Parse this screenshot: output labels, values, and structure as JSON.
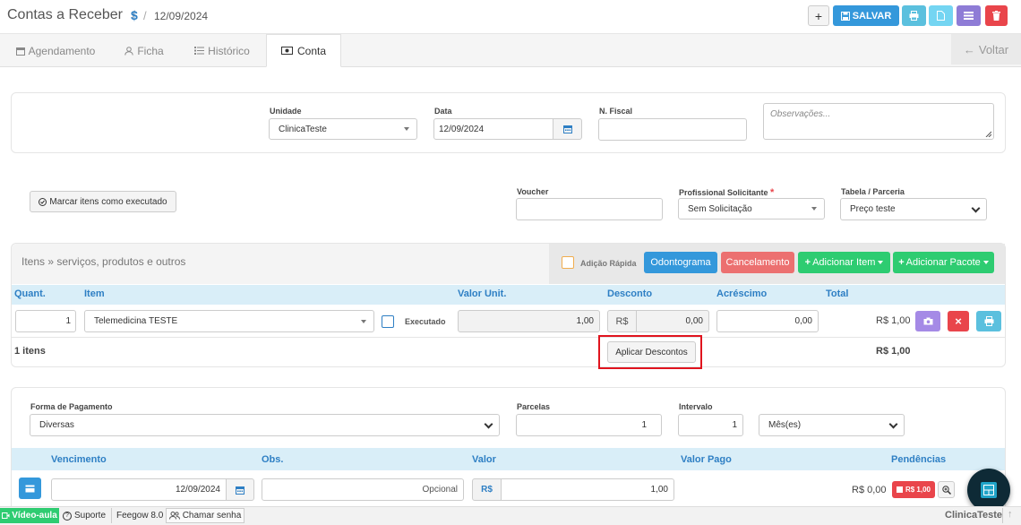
{
  "header": {
    "title": "Contas a Receber",
    "sep1": "/",
    "currency_symbol": "$",
    "sep2": "/",
    "date": "12/09/2024",
    "add_label": "+",
    "save_label": "SALVAR",
    "colors": {
      "save": "#3498db",
      "print": "#5bc0de",
      "doc": "#74d5f2",
      "menu": "#8e7cd6",
      "delete": "#e9454b"
    }
  },
  "tabs": [
    {
      "label": "Agendamento"
    },
    {
      "label": "Ficha"
    },
    {
      "label": "Histórico"
    },
    {
      "label": "Conta"
    }
  ],
  "back_label": "Voltar",
  "form1": {
    "unidade_label": "Unidade",
    "unidade_value": "ClinicaTeste",
    "data_label": "Data",
    "data_value": "12/09/2024",
    "nfiscal_label": "N. Fiscal",
    "obs_placeholder": "Observações..."
  },
  "form2": {
    "mark_executed_label": "Marcar itens como executado",
    "voucher_label": "Voucher",
    "profissional_label": "Profissional Solicitante",
    "required_mark": "*",
    "profissional_value": "Sem Solicitação",
    "tabela_label": "Tabela / Parceria",
    "tabela_value": "Preço teste"
  },
  "items": {
    "title": "Itens » serviços, produtos e outros",
    "adicao_rapida_label": "Adição Rápida",
    "odontograma_label": "Odontograma",
    "cancelamento_label": "Cancelamento",
    "add_item_label": "Adicionar Item",
    "add_pacote_label": "Adicionar Pacote",
    "columns": [
      "Quant.",
      "Item",
      "Valor Unit.",
      "Desconto",
      "Acréscimo",
      "Total"
    ],
    "row": {
      "quant": "1",
      "item": "Telemedicina TESTE",
      "executado_label": "Executado",
      "valor_unit": "1,00",
      "desconto_prefix": "R$",
      "desconto": "0,00",
      "acrescimo": "0,00",
      "total": "R$ 1,00"
    },
    "count_label": "1 itens",
    "aplicar_descontos_label": "Aplicar Descontos",
    "sum_total": "R$ 1,00"
  },
  "payment": {
    "forma_label": "Forma de Pagamento",
    "forma_value": "Diversas",
    "parcelas_label": "Parcelas",
    "parcelas_value": "1",
    "intervalo_label": "Intervalo",
    "intervalo_value": "1",
    "periodo_value": "Mês(es)",
    "columns": [
      "Vencimento",
      "Obs.",
      "Valor",
      "Valor Pago",
      "Pendências"
    ],
    "row": {
      "vencimento": "12/09/2024",
      "obs_placeholder": "Opcional",
      "valor_prefix": "R$",
      "valor": "1,00",
      "valor_pago": "R$ 0,00",
      "pendencia_badge": "R$ 1,00"
    }
  },
  "footer": {
    "video_label": "Vídeo-aula",
    "suporte_label": "Suporte",
    "version_label": "Feegow 8.0",
    "chamar_label": "Chamar senha",
    "clinic_label": "ClinicaTeste"
  }
}
